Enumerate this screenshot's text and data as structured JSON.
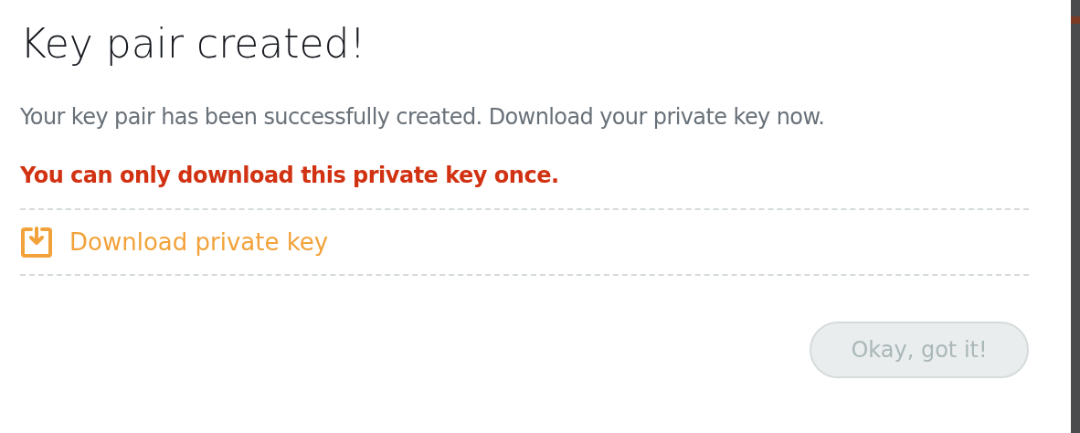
{
  "dialog": {
    "title": "Key pair created!",
    "message": "Your key pair has been successfully created. Download your private key now.",
    "warning": "You can only download this private key once.",
    "download_link": "Download private key",
    "confirm_button": {
      "label": "Okay, got it!",
      "disabled": true
    }
  }
}
